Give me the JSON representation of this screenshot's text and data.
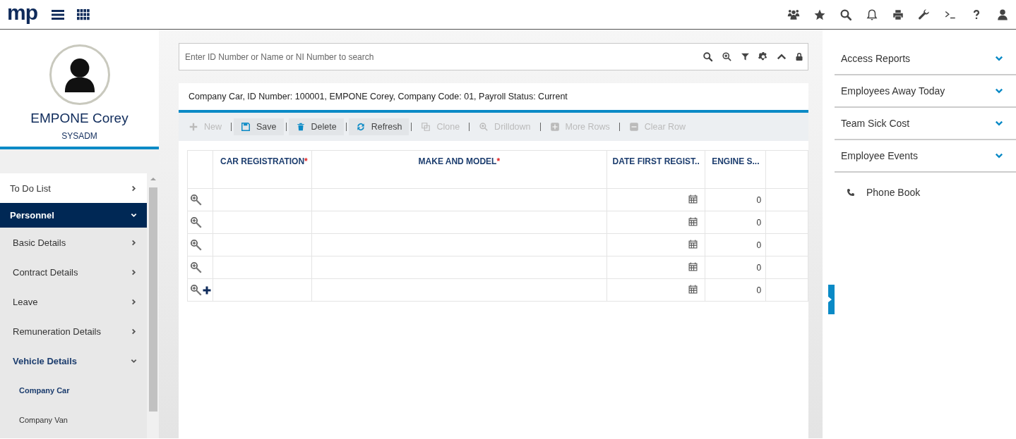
{
  "topbar": {
    "logo": "mp"
  },
  "profile": {
    "name": "EMPONE Corey",
    "role": "SYSADM"
  },
  "nav": [
    {
      "label": "To Do List",
      "expanded": false,
      "selected": false
    },
    {
      "label": "Personnel",
      "expanded": true,
      "selected": true,
      "children": [
        {
          "label": "Basic Details",
          "expanded": false,
          "selected": false
        },
        {
          "label": "Contract Details",
          "expanded": false,
          "selected": false
        },
        {
          "label": "Leave",
          "expanded": false,
          "selected": false
        },
        {
          "label": "Remuneration Details",
          "expanded": false,
          "selected": false
        },
        {
          "label": "Vehicle Details",
          "expanded": true,
          "selected": true,
          "children": [
            {
              "label": "Company Car",
              "selected": true
            },
            {
              "label": "Company Van",
              "selected": false
            }
          ]
        }
      ]
    }
  ],
  "search": {
    "placeholder": "Enter ID Number or Name or NI Number to search"
  },
  "breadcrumb": "Company Car, ID Number: 100001, EMPONE Corey, Company Code: 01, Payroll Status: Current",
  "toolbar": [
    {
      "label": "New",
      "disabled": true
    },
    {
      "label": "Save",
      "disabled": false
    },
    {
      "label": "Delete",
      "disabled": false
    },
    {
      "label": "Refresh",
      "disabled": false
    },
    {
      "label": "Clone",
      "disabled": true
    },
    {
      "label": "Drilldown",
      "disabled": true
    },
    {
      "label": "More Rows",
      "disabled": true
    },
    {
      "label": "Clear Row",
      "disabled": true
    }
  ],
  "table": {
    "columns": [
      {
        "label": "CAR REGISTRATION",
        "required_mark": "*"
      },
      {
        "label": "MAKE AND MODEL",
        "required_mark": "*"
      },
      {
        "label": "DATE FIRST REGIST.."
      },
      {
        "label": "ENGINE S..."
      }
    ],
    "rows": [
      {
        "kind": "existing",
        "engine_size": "0"
      },
      {
        "kind": "existing",
        "engine_size": "0"
      },
      {
        "kind": "existing",
        "engine_size": "0"
      },
      {
        "kind": "existing",
        "engine_size": "0"
      },
      {
        "kind": "new",
        "engine_size": "0"
      }
    ]
  },
  "right_panel": {
    "sections": [
      {
        "label": "Access Reports",
        "expanded": false
      },
      {
        "label": "Employees Away Today",
        "expanded": false
      },
      {
        "label": "Team Sick Cost",
        "expanded": false
      },
      {
        "label": "Employee Events",
        "expanded": false
      }
    ],
    "link": "Phone Book"
  }
}
